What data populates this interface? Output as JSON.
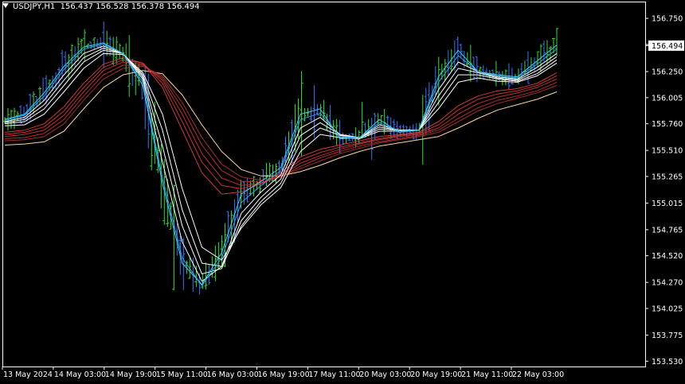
{
  "header": {
    "symbol": "USDJPY,H1",
    "ohlc": "156.437 156.528 156.378 156.494"
  },
  "chart_data": {
    "type": "line",
    "symbol": "USDJPY",
    "timeframe": "H1",
    "y_range": [
      153.48,
      156.9
    ],
    "y_ticks": [
      "156.750",
      "156.505",
      "156.250",
      "156.005",
      "155.760",
      "155.510",
      "155.265",
      "155.015",
      "154.765",
      "154.520",
      "154.270",
      "154.025",
      "153.775",
      "153.530"
    ],
    "x_ticks": [
      "13 May 2024",
      "14 May 03:00",
      "14 May 19:00",
      "15 May 11:00",
      "16 May 03:00",
      "16 May 19:00",
      "17 May 11:00",
      "20 May 03:00",
      "20 May 19:00",
      "21 May 11:00",
      "22 May 03:00"
    ],
    "current_price": "156.494",
    "bar_count": 174,
    "series": [
      {
        "period": 3,
        "color": "#3ccfff",
        "values": [
          155.8,
          155.85,
          156.05,
          156.3,
          156.48,
          156.52,
          156.42,
          156.12,
          155.2,
          154.45,
          154.25,
          154.55,
          155.1,
          155.22,
          155.35,
          155.85,
          155.9,
          155.62,
          155.63,
          155.8,
          155.68,
          155.7,
          156.2,
          156.45,
          156.25,
          156.22,
          156.2,
          156.35,
          156.5
        ]
      },
      {
        "period": 5,
        "color": "#2aa3f0",
        "values": [
          155.79,
          155.84,
          156.02,
          156.27,
          156.46,
          156.51,
          156.42,
          156.15,
          155.25,
          154.5,
          154.24,
          154.5,
          155.02,
          155.18,
          155.32,
          155.8,
          155.86,
          155.64,
          155.63,
          155.77,
          155.69,
          155.7,
          156.15,
          156.4,
          156.25,
          156.21,
          156.19,
          156.32,
          156.46
        ]
      },
      {
        "period": 8,
        "color": "#ffffff",
        "values": [
          155.78,
          155.82,
          155.98,
          156.22,
          156.42,
          156.49,
          156.42,
          156.18,
          155.4,
          154.65,
          154.28,
          154.42,
          154.92,
          155.12,
          155.28,
          155.72,
          155.82,
          155.66,
          155.63,
          155.75,
          155.7,
          155.7,
          156.08,
          156.34,
          156.25,
          156.2,
          156.18,
          156.29,
          156.42
        ]
      },
      {
        "period": 10,
        "color": "#ffffff",
        "values": [
          155.77,
          155.8,
          155.94,
          156.17,
          156.38,
          156.47,
          156.42,
          156.2,
          155.55,
          154.8,
          154.35,
          154.4,
          154.85,
          155.07,
          155.24,
          155.65,
          155.77,
          155.66,
          155.63,
          155.73,
          155.7,
          155.7,
          156.02,
          156.28,
          156.24,
          156.19,
          156.17,
          156.26,
          156.39
        ]
      },
      {
        "period": 12,
        "color": "#ffffff",
        "values": [
          155.76,
          155.78,
          155.9,
          156.12,
          156.34,
          156.45,
          156.42,
          156.22,
          155.7,
          154.95,
          154.45,
          154.42,
          154.8,
          155.03,
          155.2,
          155.58,
          155.72,
          155.65,
          155.63,
          155.71,
          155.7,
          155.7,
          155.96,
          156.22,
          156.22,
          156.18,
          156.16,
          156.23,
          156.36
        ]
      },
      {
        "period": 15,
        "color": "#ffffff",
        "values": [
          155.74,
          155.75,
          155.85,
          156.06,
          156.28,
          156.42,
          156.41,
          156.24,
          155.85,
          155.15,
          154.6,
          154.48,
          154.78,
          155.0,
          155.16,
          155.5,
          155.66,
          155.63,
          155.62,
          155.69,
          155.69,
          155.7,
          155.9,
          156.15,
          156.19,
          156.16,
          156.15,
          156.21,
          156.33
        ]
      },
      {
        "period": 30,
        "color": "#d23a3a",
        "values": [
          155.68,
          155.7,
          155.76,
          155.92,
          156.14,
          156.32,
          156.38,
          156.33,
          156.1,
          155.7,
          155.3,
          155.1,
          155.12,
          155.2,
          155.3,
          155.45,
          155.52,
          155.56,
          155.6,
          155.64,
          155.66,
          155.68,
          155.78,
          155.93,
          156.02,
          156.07,
          156.09,
          156.14,
          156.24
        ]
      },
      {
        "period": 35,
        "color": "#c93434",
        "values": [
          155.66,
          155.68,
          155.73,
          155.88,
          156.1,
          156.29,
          156.36,
          156.33,
          156.14,
          155.78,
          155.4,
          155.18,
          155.15,
          155.2,
          155.28,
          155.42,
          155.49,
          155.54,
          155.58,
          155.62,
          155.65,
          155.67,
          155.75,
          155.89,
          155.99,
          156.04,
          156.07,
          156.12,
          156.21
        ]
      },
      {
        "period": 40,
        "color": "#bf3030",
        "values": [
          155.64,
          155.66,
          155.7,
          155.84,
          156.06,
          156.26,
          156.34,
          156.32,
          156.17,
          155.85,
          155.48,
          155.25,
          155.18,
          155.2,
          155.27,
          155.39,
          155.46,
          155.52,
          155.57,
          155.61,
          155.64,
          155.66,
          155.72,
          155.85,
          155.95,
          156.01,
          156.05,
          156.1,
          156.18
        ]
      },
      {
        "period": 45,
        "color": "#b22e2e",
        "values": [
          155.62,
          155.63,
          155.67,
          155.8,
          156.02,
          156.22,
          156.31,
          156.31,
          156.19,
          155.91,
          155.56,
          155.32,
          155.22,
          155.21,
          155.26,
          155.36,
          155.44,
          155.5,
          155.55,
          155.59,
          155.62,
          155.65,
          155.7,
          155.81,
          155.91,
          155.98,
          156.02,
          156.07,
          156.15
        ]
      },
      {
        "period": 50,
        "color": "#a52c2c",
        "values": [
          155.6,
          155.61,
          155.64,
          155.76,
          155.98,
          156.18,
          156.28,
          156.3,
          156.21,
          155.96,
          155.63,
          155.38,
          155.26,
          155.23,
          155.26,
          155.34,
          155.41,
          155.48,
          155.53,
          155.58,
          155.61,
          155.64,
          155.68,
          155.78,
          155.88,
          155.95,
          156.0,
          156.05,
          156.12
        ]
      },
      {
        "period": 60,
        "color": "#ffd6a0",
        "values": [
          155.56,
          155.57,
          155.59,
          155.69,
          155.9,
          156.1,
          156.22,
          156.26,
          156.23,
          156.03,
          155.75,
          155.5,
          155.33,
          155.27,
          155.27,
          155.31,
          155.37,
          155.44,
          155.5,
          155.55,
          155.58,
          155.61,
          155.64,
          155.72,
          155.81,
          155.89,
          155.94,
          155.99,
          156.06
        ]
      }
    ]
  }
}
